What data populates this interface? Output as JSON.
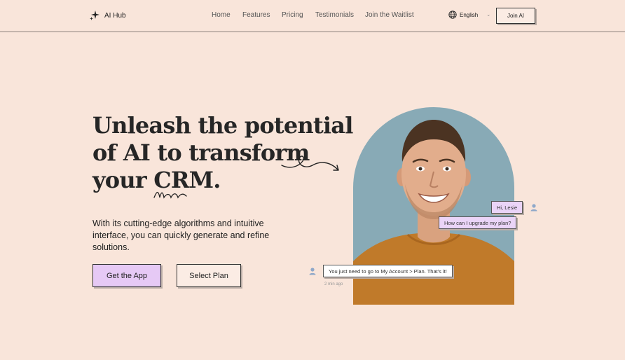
{
  "header": {
    "brand": "AI Hub",
    "nav": [
      "Home",
      "Features",
      "Pricing",
      "Testimonials",
      "Join the Waitlist"
    ],
    "language": "English",
    "join_label": "Join AI"
  },
  "hero": {
    "headline_lines": [
      "Unleash the potential",
      "of AI to transform",
      "your CRM."
    ],
    "subtext": "With its cutting-edge algorithms and intuitive interface, you can quickly generate and refine solutions.",
    "primary_button": "Get the App",
    "secondary_button": "Select Plan"
  },
  "chat": {
    "messages": [
      {
        "text": "Hi, Lesie"
      },
      {
        "text": "How can I upgrade my plan?"
      },
      {
        "text": "You just need to go to My Account > Plan. That's it!"
      }
    ],
    "timestamp": "2 min ago"
  },
  "colors": {
    "background": "#f9e5da",
    "accent_purple": "#e6c9f5",
    "arch_blue": "#88aab6",
    "shirt_orange": "#c07a2a"
  }
}
